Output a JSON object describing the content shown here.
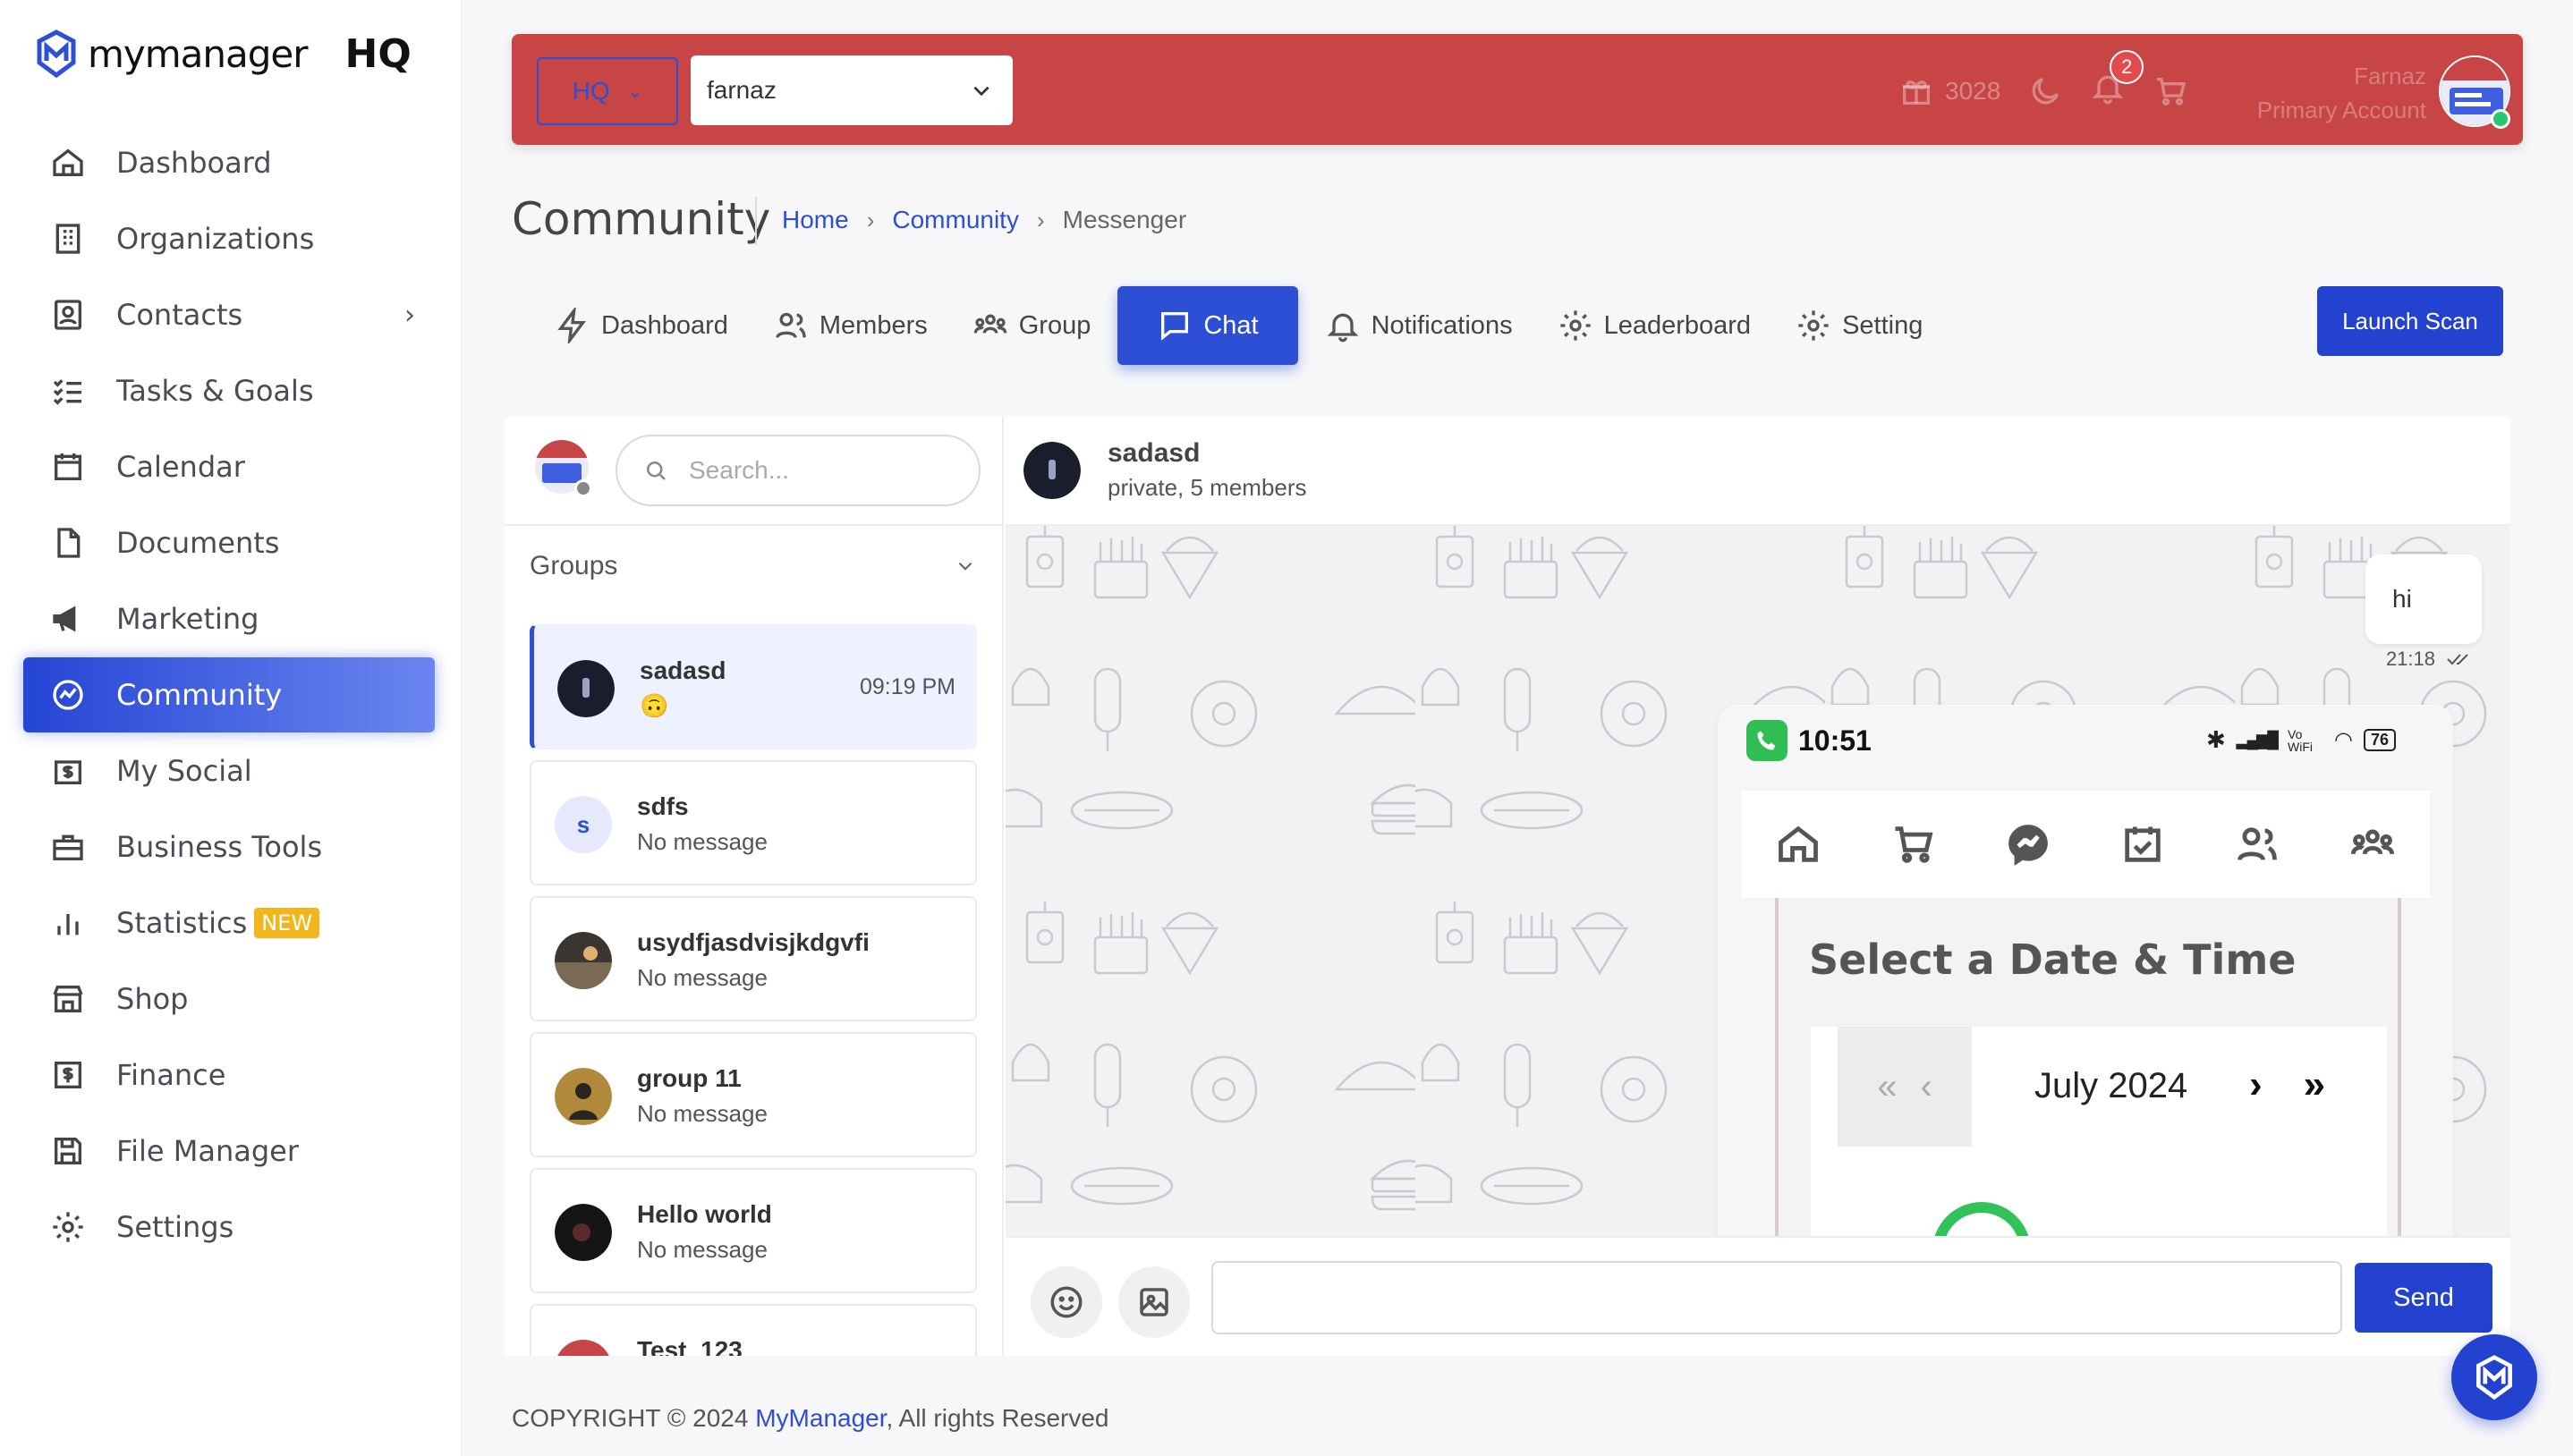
{
  "brand": {
    "name": "mymanager",
    "hq": "HQ"
  },
  "sidebar": {
    "items": [
      {
        "label": "Dashboard",
        "icon": "home-icon"
      },
      {
        "label": "Organizations",
        "icon": "building-icon"
      },
      {
        "label": "Contacts",
        "icon": "contacts-icon",
        "has_children": true
      },
      {
        "label": "Tasks & Goals",
        "icon": "checklist-icon"
      },
      {
        "label": "Calendar",
        "icon": "calendar-icon"
      },
      {
        "label": "Documents",
        "icon": "document-icon"
      },
      {
        "label": "Marketing",
        "icon": "megaphone-icon"
      },
      {
        "label": "Community",
        "icon": "community-icon",
        "active": true
      },
      {
        "label": "My Social",
        "icon": "dollar-board-icon"
      },
      {
        "label": "Business Tools",
        "icon": "toolbox-icon"
      },
      {
        "label": "Statistics",
        "icon": "bar-chart-icon",
        "badge": "NEW"
      },
      {
        "label": "Shop",
        "icon": "shop-icon"
      },
      {
        "label": "Finance",
        "icon": "finance-icon"
      },
      {
        "label": "File Manager",
        "icon": "save-icon"
      },
      {
        "label": "Settings",
        "icon": "gear-icon"
      }
    ]
  },
  "topbar": {
    "hq_select": "HQ",
    "org_select": "farnaz",
    "points": "3028",
    "notifications_count": "2",
    "user_name": "Farnaz",
    "user_role": "Primary Account",
    "bar_color": "#c84545"
  },
  "page": {
    "title": "Community",
    "breadcrumb": [
      "Home",
      "Community",
      "Messenger"
    ]
  },
  "tabs": [
    {
      "label": "Dashboard",
      "icon": "bolt-icon"
    },
    {
      "label": "Members",
      "icon": "members-icon"
    },
    {
      "label": "Group",
      "icon": "group-icon"
    },
    {
      "label": "Chat",
      "icon": "chat-icon",
      "active": true
    },
    {
      "label": "Notifications",
      "icon": "bell-icon"
    },
    {
      "label": "Leaderboard",
      "icon": "gear-icon"
    },
    {
      "label": "Setting",
      "icon": "gear-icon"
    }
  ],
  "launch_scan": "Launch Scan",
  "chat": {
    "search_placeholder": "Search...",
    "groups_label": "Groups",
    "groups": [
      {
        "name": "sadasd",
        "message": "🙃",
        "time": "09:19 PM",
        "active": true
      },
      {
        "name": "sdfs",
        "message": "No message",
        "letter": "s"
      },
      {
        "name": "usydfjasdvisjkdgvfi",
        "message": "No message"
      },
      {
        "name": "group 11",
        "message": "No message"
      },
      {
        "name": "Hello world",
        "message": "No message"
      },
      {
        "name": "Test_123",
        "message": ""
      }
    ],
    "conversation": {
      "name": "sadasd",
      "subtitle": "private, 5 members",
      "outgoing_text": "hi",
      "outgoing_time": "21:18"
    },
    "attachment": {
      "clock": "10:51",
      "battery": "76",
      "network": "Vo WiFi",
      "heading": "Select a Date & Time",
      "month": "July 2024",
      "prev_double": "«",
      "prev_single": "‹",
      "next_single": "›",
      "next_double": "»"
    },
    "message_value": "",
    "send_label": "Send"
  },
  "footer": {
    "prefix": "COPYRIGHT © 2024 ",
    "link": "MyManager",
    "suffix": ", All rights Reserved"
  },
  "colors": {
    "accent": "#2c4fd6",
    "primary_button": "#2342cf",
    "online": "#28c76f",
    "badge_new": "#f2b61c"
  }
}
